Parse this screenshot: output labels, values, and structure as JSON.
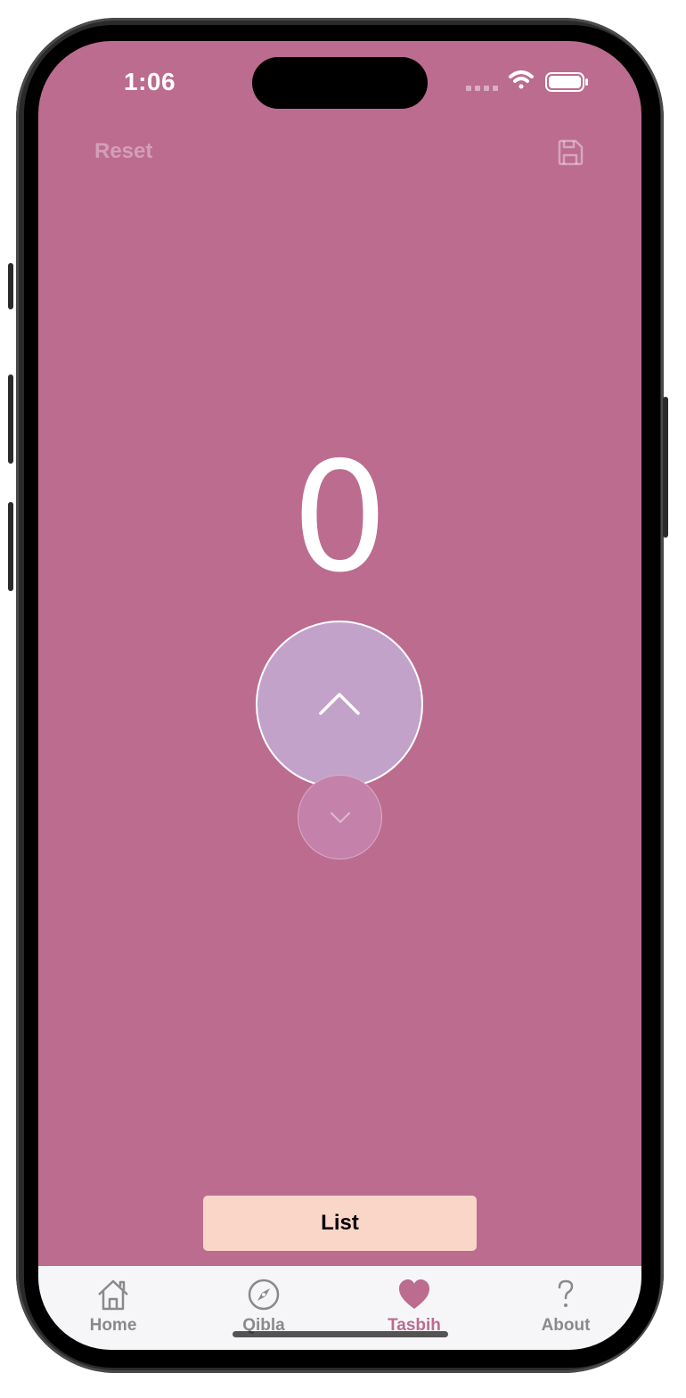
{
  "colors": {
    "background": "#bc6c8f",
    "increment_button": "#c2a2c9",
    "decrement_button": "#c481a9",
    "list_button": "#f9d6c7",
    "tab_active": "#bc6c8f",
    "tab_inactive": "#8a8a8e",
    "tabbar_bg": "#f6f6f8"
  },
  "status_bar": {
    "time": "1:06",
    "icons": [
      "cellular-icon",
      "wifi-icon",
      "battery-icon"
    ]
  },
  "header": {
    "reset_label": "Reset",
    "save_icon": "save-icon"
  },
  "counter": {
    "value": "0"
  },
  "controls": {
    "increment_icon": "chevron-up-icon",
    "decrement_icon": "chevron-down-icon"
  },
  "list_button": {
    "label": "List"
  },
  "tabbar": {
    "items": [
      {
        "label": "Home",
        "icon": "house-icon",
        "active": false
      },
      {
        "label": "Qibla",
        "icon": "compass-icon",
        "active": false
      },
      {
        "label": "Tasbih",
        "icon": "heart-icon",
        "active": true
      },
      {
        "label": "About",
        "icon": "question-icon",
        "active": false
      }
    ]
  }
}
